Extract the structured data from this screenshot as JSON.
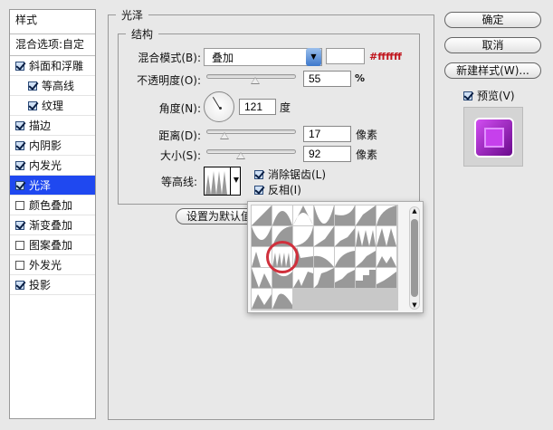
{
  "sidebar": {
    "header": "样式",
    "blend_options": "混合选项:自定",
    "items": [
      {
        "label": "斜面和浮雕",
        "checked": true,
        "indent": false
      },
      {
        "label": "等高线",
        "checked": true,
        "indent": true
      },
      {
        "label": "纹理",
        "checked": true,
        "indent": true
      },
      {
        "label": "描边",
        "checked": true,
        "indent": false
      },
      {
        "label": "内阴影",
        "checked": true,
        "indent": false
      },
      {
        "label": "内发光",
        "checked": true,
        "indent": false
      },
      {
        "label": "光泽",
        "checked": true,
        "indent": false,
        "selected": true
      },
      {
        "label": "颜色叠加",
        "checked": false,
        "indent": false
      },
      {
        "label": "渐变叠加",
        "checked": true,
        "indent": false
      },
      {
        "label": "图案叠加",
        "checked": false,
        "indent": false
      },
      {
        "label": "外发光",
        "checked": false,
        "indent": false
      },
      {
        "label": "投影",
        "checked": true,
        "indent": false
      }
    ]
  },
  "panel": {
    "title": "光泽",
    "group": "结构",
    "blend_mode_label": "混合模式(B):",
    "blend_mode": "叠加",
    "color_hex": "#ffffff",
    "color_annotation_color": "#c0141c",
    "opacity_label": "不透明度(O):",
    "opacity": "55",
    "opacity_unit": "%",
    "opacity_pct": 55,
    "angle_label": "角度(N):",
    "angle": "121",
    "angle_unit": "度",
    "distance_label": "距离(D):",
    "distance": "17",
    "distance_unit": "像素",
    "distance_pct": 17,
    "size_label": "大小(S):",
    "size": "92",
    "size_unit": "像素",
    "size_pct": 37,
    "contour_label": "等高线:",
    "antialias_label": "消除锯齿(L)",
    "antialias": true,
    "invert_label": "反相(I)",
    "invert": true,
    "reset_default": "设置为默认值"
  },
  "buttons": {
    "ok": "确定",
    "cancel": "取消",
    "new_style": "新建样式(W)...",
    "preview_label": "预览(V)",
    "preview": true
  },
  "contour_picker": {
    "count": 30,
    "selected_index": 15
  }
}
